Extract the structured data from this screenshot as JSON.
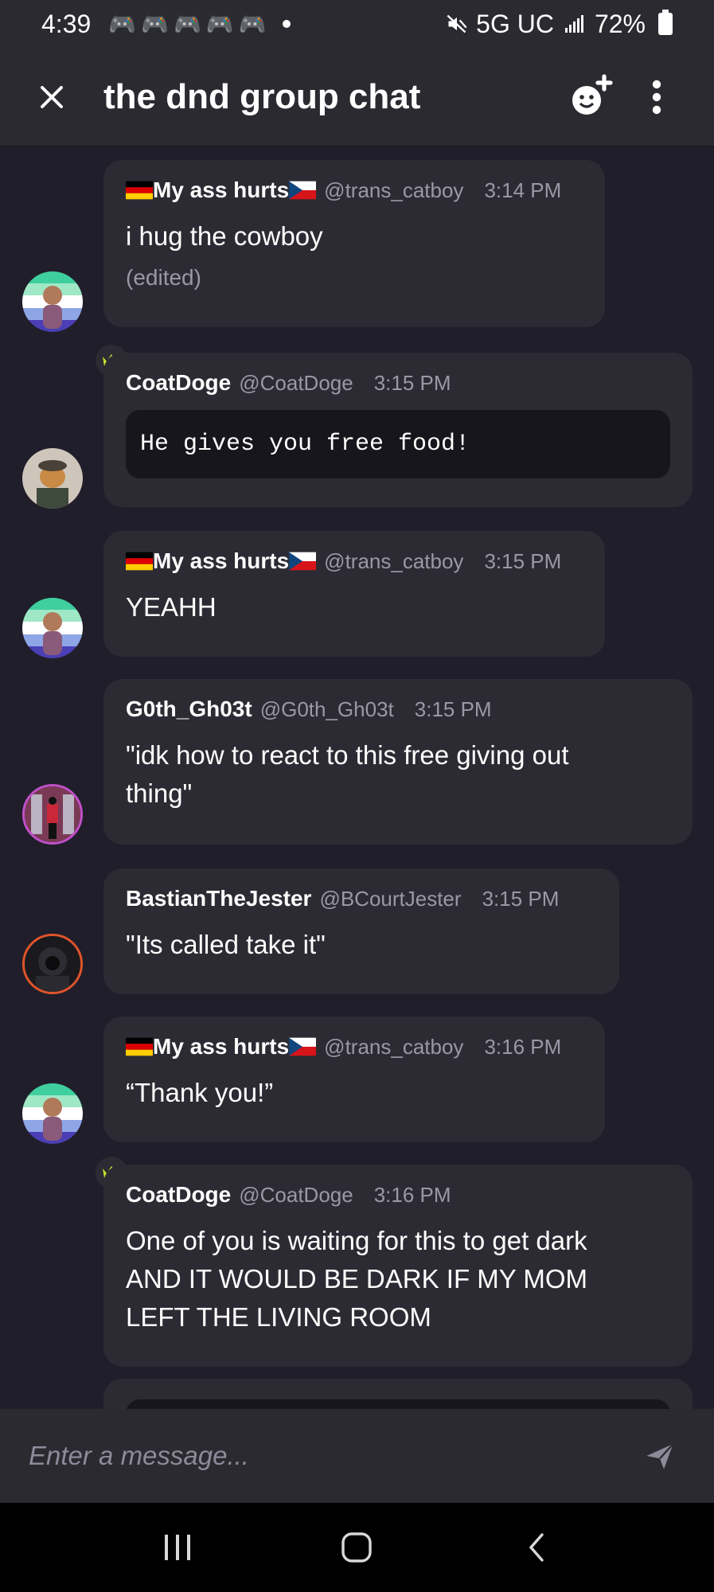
{
  "status_bar": {
    "time": "4:39",
    "network": "5G UC",
    "battery": "72%"
  },
  "header": {
    "title": "the dnd group chat",
    "icons": [
      "close-icon",
      "add-reaction-icon",
      "more-vertical-icon"
    ]
  },
  "messages": [
    {
      "name_before": "",
      "name": "My ass hurts",
      "handle": "@trans_catboy",
      "time": "3:14 PM",
      "text": "i hug the cowboy",
      "edited": "(edited)"
    },
    {
      "name": "CoatDoge",
      "handle": "@CoatDoge",
      "time": "3:15 PM",
      "code": "He gives you free food!"
    },
    {
      "name": "My ass hurts",
      "handle": "@trans_catboy",
      "time": "3:15 PM",
      "text": "YEAHH"
    },
    {
      "name": "G0th_Gh03t",
      "handle": "@G0th_Gh03t",
      "time": "3:15 PM",
      "text_lines": [
        "\"idk how to react to this free giving out",
        "thing\""
      ]
    },
    {
      "name": "BastianTheJester",
      "handle": "@BCourtJester",
      "time": "3:15 PM",
      "text": "\"Its called take it\""
    },
    {
      "name": "My ass hurts",
      "handle": "@trans_catboy",
      "time": "3:16 PM",
      "text": "“Thank you!”"
    },
    {
      "name": "CoatDoge",
      "handle": "@CoatDoge",
      "time": "3:16 PM",
      "text_lines": [
        "One of you is waiting for this to get dark",
        "AND IT WOULD BE DARK IF MY MOM",
        "LEFT THE LIVING ROOM"
      ]
    }
  ],
  "composer": {
    "placeholder": "Enter a message..."
  },
  "colors": {
    "background": "#201e2a",
    "bubble": "#2c2b33",
    "header": "#2b2a31",
    "crown": "#c6e62a"
  }
}
